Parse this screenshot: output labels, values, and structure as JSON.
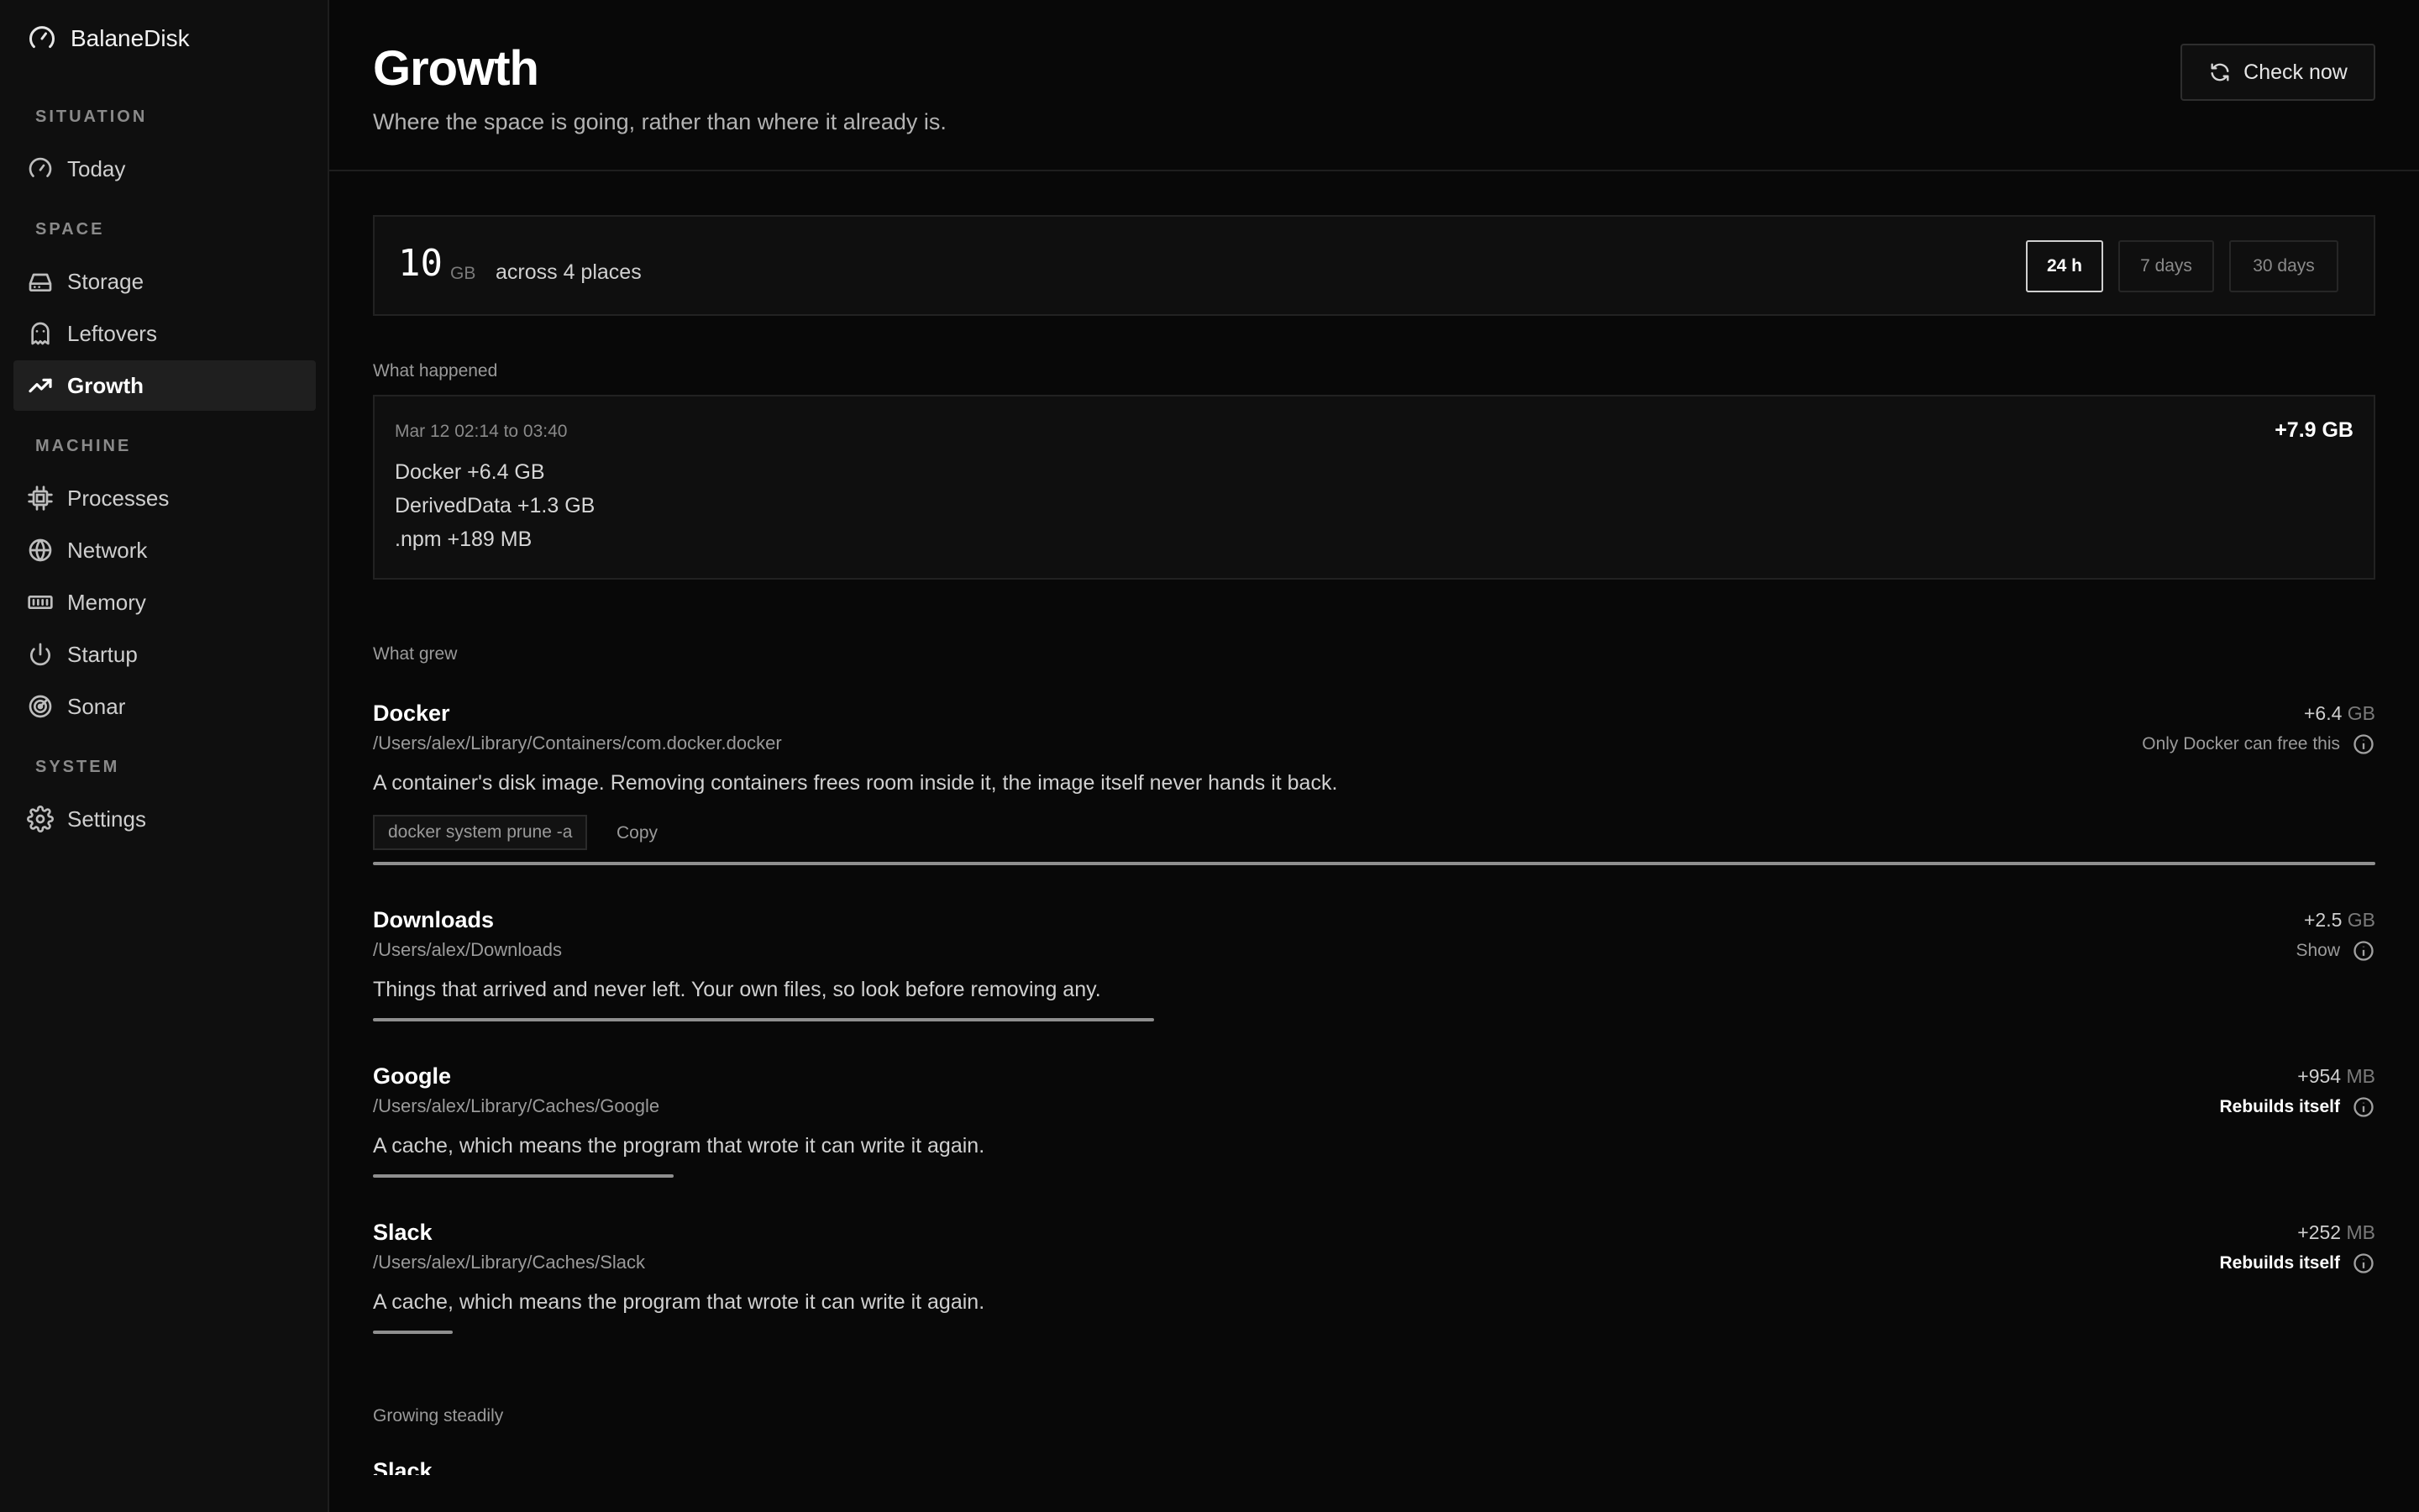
{
  "app": {
    "name": "BalaneDisk",
    "logo_icon": "gauge-icon"
  },
  "sidebar": {
    "sections": [
      {
        "label": "SITUATION",
        "items": [
          {
            "label": "Today",
            "icon": "gauge-icon"
          }
        ]
      },
      {
        "label": "SPACE",
        "items": [
          {
            "label": "Storage",
            "icon": "hard-drive-icon"
          },
          {
            "label": "Leftovers",
            "icon": "ghost-icon"
          },
          {
            "label": "Growth",
            "icon": "trending-up-icon",
            "active": true
          }
        ]
      },
      {
        "label": "MACHINE",
        "items": [
          {
            "label": "Processes",
            "icon": "cpu-icon"
          },
          {
            "label": "Network",
            "icon": "globe-icon"
          },
          {
            "label": "Memory",
            "icon": "memory-icon"
          },
          {
            "label": "Startup",
            "icon": "power-icon"
          },
          {
            "label": "Sonar",
            "icon": "radar-icon"
          }
        ]
      },
      {
        "label": "SYSTEM",
        "items": [
          {
            "label": "Settings",
            "icon": "gear-icon"
          }
        ]
      }
    ]
  },
  "header": {
    "title": "Growth",
    "subtitle": "Where the space is going, rather than where it already is.",
    "check_button": "Check now"
  },
  "summary": {
    "value": "10",
    "unit": "GB",
    "text": "across 4 places",
    "ranges": [
      {
        "label": "24 h",
        "active": true
      },
      {
        "label": "7 days"
      },
      {
        "label": "30 days"
      }
    ]
  },
  "what_happened": {
    "label": "What happened",
    "range": "Mar 12 02:14 to 03:40",
    "total": "+7.9 GB",
    "lines": [
      "Docker +6.4 GB",
      "DerivedData +1.3 GB",
      ".npm +189 MB"
    ]
  },
  "what_grew": {
    "label": "What grew",
    "items": [
      {
        "name": "Docker",
        "path": "/Users/alex/Library/Containers/com.docker.docker",
        "description": "A container's disk image. Removing containers frees room inside it, the image itself never hands it back.",
        "amount": "+6.4",
        "unit": "GB",
        "note": "Only Docker can free this",
        "note_strong": false,
        "command": "docker system prune -a",
        "copy_label": "Copy",
        "share": 1.0
      },
      {
        "name": "Downloads",
        "path": "/Users/alex/Downloads",
        "description": "Things that arrived and never left. Your own files, so look before removing any.",
        "amount": "+2.5",
        "unit": "GB",
        "note": "Show",
        "note_strong": false,
        "share": 0.39
      },
      {
        "name": "Google",
        "path": "/Users/alex/Library/Caches/Google",
        "description": "A cache, which means the program that wrote it can write it again.",
        "amount": "+954",
        "unit": "MB",
        "note": "Rebuilds itself",
        "note_strong": true,
        "share": 0.15
      },
      {
        "name": "Slack",
        "path": "/Users/alex/Library/Caches/Slack",
        "description": "A cache, which means the program that wrote it can write it again.",
        "amount": "+252",
        "unit": "MB",
        "note": "Rebuilds itself",
        "note_strong": true,
        "share": 0.04
      }
    ]
  },
  "growing_steadily": {
    "label": "Growing steadily",
    "first_item": "Slack"
  }
}
